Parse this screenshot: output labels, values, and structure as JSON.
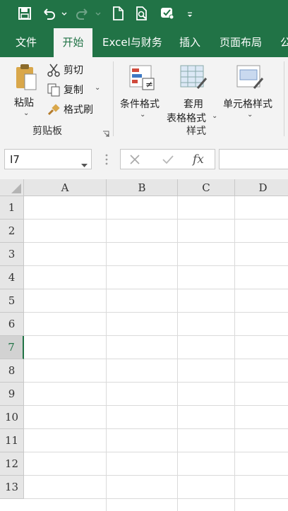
{
  "quick_access": {
    "icons": [
      "save-icon",
      "undo-icon",
      "redo-icon",
      "new-file-icon",
      "print-preview-icon",
      "touch-mode-icon",
      "customize-qat-icon"
    ]
  },
  "tabs": [
    "文件",
    "开始",
    "Excel与财务",
    "插入",
    "页面布局",
    "公"
  ],
  "active_tab": "开始",
  "ribbon": {
    "clipboard": {
      "paste": "粘贴",
      "cut": "剪切",
      "copy": "复制",
      "format_painter": "格式刷",
      "group_label": "剪贴板"
    },
    "styles": {
      "conditional_format": "条件格式",
      "table_format_line1": "套用",
      "table_format_line2": "表格格式",
      "cell_styles": "单元格样式",
      "group_label": "样式"
    }
  },
  "formula_bar": {
    "name_box": "I7",
    "formula": ""
  },
  "sheet": {
    "columns": [
      "A",
      "B",
      "C",
      "D"
    ],
    "rows": [
      "1",
      "2",
      "3",
      "4",
      "5",
      "6",
      "7",
      "8",
      "9",
      "10",
      "11",
      "12",
      "13"
    ],
    "selected_row": "7"
  },
  "colors": {
    "accent": "#217346",
    "ribbon_bg": "#f3f3f3"
  }
}
